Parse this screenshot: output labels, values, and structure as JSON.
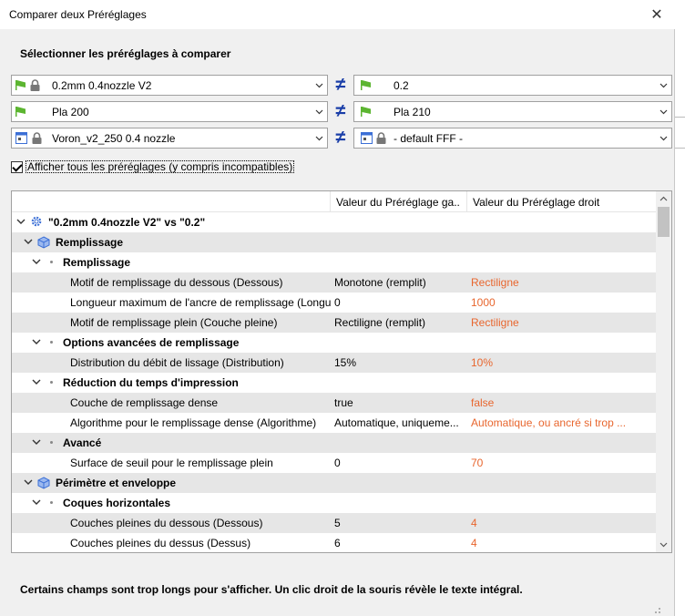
{
  "window": {
    "title": "Comparer deux Préréglages",
    "close_glyph": "✕"
  },
  "selector": {
    "title": "Sélectionner les préréglages à comparer",
    "neq_glyph": "≠",
    "rows": [
      {
        "left": "0.2mm 0.4nozzle V2",
        "right": "0.2"
      },
      {
        "left": "Pla 200",
        "right": "Pla 210"
      },
      {
        "left": "Voron_v2_250 0.4 nozzle",
        "right": "- default FFF -"
      }
    ]
  },
  "show_all": {
    "checked": true,
    "label": "Afficher tous les préréglages (y compris incompatibles)"
  },
  "table": {
    "columns": [
      "",
      "Valeur du Préréglage ga...",
      "Valeur du Préréglage droit"
    ],
    "rows": [
      {
        "level": 0,
        "icon": "gear-icon",
        "label": "\"0.2mm 0.4nozzle V2\" vs \"0.2\"",
        "left": "",
        "right": ""
      },
      {
        "level": 1,
        "icon": "cube-icon",
        "label": "Remplissage",
        "left": "",
        "right": ""
      },
      {
        "level": 2,
        "icon": "dot-icon",
        "label": "Remplissage",
        "left": "",
        "right": ""
      },
      {
        "level": 3,
        "label": "Motif de remplissage du dessous (Dessous)",
        "left": "Monotone (remplit)",
        "right": "Rectiligne"
      },
      {
        "level": 3,
        "label": "Longueur maximum de l'ancre de remplissage (Longu",
        "left": "0",
        "right": "1000"
      },
      {
        "level": 3,
        "label": "Motif de remplissage plein (Couche pleine)",
        "left": "Rectiligne (remplit)",
        "right": "Rectiligne"
      },
      {
        "level": 2,
        "icon": "dot-icon",
        "label": "Options avancées de remplissage",
        "left": "",
        "right": ""
      },
      {
        "level": 3,
        "label": "Distribution du débit de lissage (Distribution)",
        "left": "15%",
        "right": "10%"
      },
      {
        "level": 2,
        "icon": "dot-icon",
        "label": "Réduction du temps d'impression",
        "left": "",
        "right": ""
      },
      {
        "level": 3,
        "label": "Couche de remplissage dense",
        "left": "true",
        "right": "false"
      },
      {
        "level": 3,
        "label": "Algorithme pour le remplissage dense (Algorithme)",
        "left": "Automatique, uniqueme...",
        "right": "Automatique, ou ancré si trop ..."
      },
      {
        "level": 2,
        "icon": "dot-icon",
        "label": "Avancé",
        "left": "",
        "right": ""
      },
      {
        "level": 3,
        "label": "Surface de seuil pour le remplissage plein",
        "left": "0",
        "right": "70"
      },
      {
        "level": 1,
        "icon": "cube-icon",
        "label": "Périmètre et enveloppe",
        "left": "",
        "right": ""
      },
      {
        "level": 2,
        "icon": "dot-icon",
        "label": "Coques horizontales",
        "left": "",
        "right": ""
      },
      {
        "level": 3,
        "label": "Couches pleines du dessous (Dessous)",
        "left": "5",
        "right": "4"
      },
      {
        "level": 3,
        "label": "Couches pleines du dessus (Dessus)",
        "left": "6",
        "right": "4"
      }
    ]
  },
  "footer": {
    "note": "Certains champs sont trop longs pour s'afficher. Un clic droit de la souris révèle le texte intégral."
  },
  "colors": {
    "changed_value": "#e8662e",
    "neq": "#1a3ea8",
    "flag": "#5cb531",
    "cube": "#3b6fd6"
  }
}
